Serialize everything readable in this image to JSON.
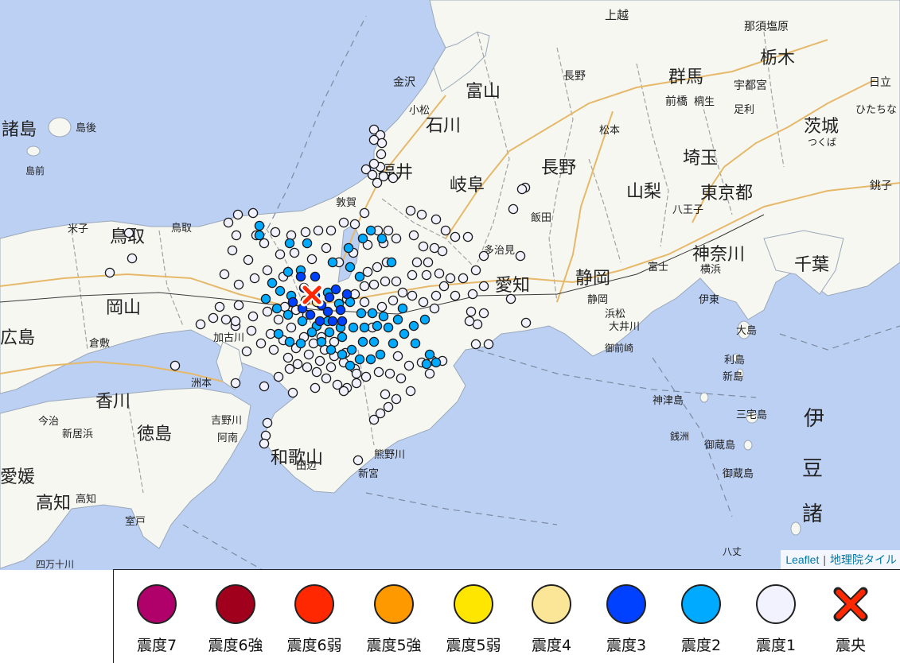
{
  "map": {
    "attribution": {
      "leaflet": "Leaflet",
      "separator": "|",
      "gsi": "地理院タイル"
    },
    "place_labels": [
      {
        "t": "上越",
        "s": 15
      },
      {
        "t": "那須塩原",
        "s": 14
      },
      {
        "t": "栃木",
        "s": 22
      },
      {
        "t": "金沢",
        "s": 14
      },
      {
        "t": "長野",
        "s": 14
      },
      {
        "t": "群馬",
        "s": 22
      },
      {
        "t": "宇都宮",
        "s": 14
      },
      {
        "t": "富山",
        "s": 22
      },
      {
        "t": "前橋",
        "s": 14
      },
      {
        "t": "桐生",
        "s": 13
      },
      {
        "t": "足利",
        "s": 13
      },
      {
        "t": "日立",
        "s": 14
      },
      {
        "t": "小松",
        "s": 13
      },
      {
        "t": "石川",
        "s": 22
      },
      {
        "t": "茨城",
        "s": 22
      },
      {
        "t": "ひたちな",
        "s": 13
      },
      {
        "t": "諸島",
        "s": 22
      },
      {
        "t": "島後",
        "s": 13
      },
      {
        "t": "松本",
        "s": 13
      },
      {
        "t": "福井",
        "s": 22
      },
      {
        "t": "埼玉",
        "s": 22
      },
      {
        "t": "つくば",
        "s": 12
      },
      {
        "t": "長野",
        "s": 22
      },
      {
        "t": "岐阜",
        "s": 22
      },
      {
        "t": "山梨",
        "s": 22
      },
      {
        "t": "東京都",
        "s": 22
      },
      {
        "t": "銚子",
        "s": 14
      },
      {
        "t": "島前",
        "s": 12
      },
      {
        "t": "敦賀",
        "s": 13
      },
      {
        "t": "飯田",
        "s": 13
      },
      {
        "t": "八王子",
        "s": 13
      },
      {
        "t": "鳥取",
        "s": 22
      },
      {
        "t": "鳥取",
        "s": 13
      },
      {
        "t": "米子",
        "s": 13
      },
      {
        "t": "多治見",
        "s": 13
      },
      {
        "t": "神奈川",
        "s": 22
      },
      {
        "t": "千葉",
        "s": 22
      },
      {
        "t": "愛知",
        "s": 22
      },
      {
        "t": "静岡",
        "s": 22
      },
      {
        "t": "富士",
        "s": 13
      },
      {
        "t": "横浜",
        "s": 13
      },
      {
        "t": "岡山",
        "s": 22
      },
      {
        "t": "静岡",
        "s": 13
      },
      {
        "t": "伊東",
        "s": 13
      },
      {
        "t": "浜松",
        "s": 13
      },
      {
        "t": "大井川",
        "s": 13
      },
      {
        "t": "大島",
        "s": 13
      },
      {
        "t": "加古川",
        "s": 13
      },
      {
        "t": "倉敷",
        "s": 13
      },
      {
        "t": "広島",
        "s": 22
      },
      {
        "t": "御前崎",
        "s": 12
      },
      {
        "t": "利島",
        "s": 13
      },
      {
        "t": "新島",
        "s": 13
      },
      {
        "t": "香川",
        "s": 22
      },
      {
        "t": "今治",
        "s": 13
      },
      {
        "t": "洲本",
        "s": 13
      },
      {
        "t": "神津島",
        "s": 13
      },
      {
        "t": "三宅島",
        "s": 13
      },
      {
        "t": "伊",
        "s": 26
      },
      {
        "t": "徳島",
        "s": 22
      },
      {
        "t": "新居浜",
        "s": 13
      },
      {
        "t": "吉野川",
        "s": 13
      },
      {
        "t": "和歌山",
        "s": 22
      },
      {
        "t": "阿南",
        "s": 13
      },
      {
        "t": "銭洲",
        "s": 12
      },
      {
        "t": "御蔵島",
        "s": 13
      },
      {
        "t": "田辺",
        "s": 13
      },
      {
        "t": "熊野川",
        "s": 13
      },
      {
        "t": "豆",
        "s": 26
      },
      {
        "t": "愛媛",
        "s": 22
      },
      {
        "t": "新宮",
        "s": 13
      },
      {
        "t": "御蔵島",
        "s": 13
      },
      {
        "t": "高知",
        "s": 22
      },
      {
        "t": "高知",
        "s": 13
      },
      {
        "t": "諸",
        "s": 26
      },
      {
        "t": "室戸",
        "s": 13
      },
      {
        "t": "八丈",
        "s": 12
      },
      {
        "t": "四万十川",
        "s": 12
      }
    ],
    "epicenter_icon": "x-mark-icon"
  },
  "legend": {
    "items": [
      {
        "label": "震度7",
        "color": "#b0006a",
        "icon": "circle-icon"
      },
      {
        "label": "震度6強",
        "color": "#a0001c",
        "icon": "circle-icon"
      },
      {
        "label": "震度6弱",
        "color": "#ff2800",
        "icon": "circle-icon"
      },
      {
        "label": "震度5強",
        "color": "#ff9900",
        "icon": "circle-icon"
      },
      {
        "label": "震度5弱",
        "color": "#ffe600",
        "icon": "circle-icon"
      },
      {
        "label": "震度4",
        "color": "#fae696",
        "icon": "circle-icon"
      },
      {
        "label": "震度3",
        "color": "#0041ff",
        "icon": "circle-icon"
      },
      {
        "label": "震度2",
        "color": "#00aaff",
        "icon": "circle-icon"
      },
      {
        "label": "震度1",
        "color": "#f2f2ff",
        "icon": "circle-icon"
      },
      {
        "label": "震央",
        "color": "#ff2800",
        "icon": "x-mark-icon"
      }
    ]
  },
  "colors": {
    "sea": "#bcd0f4",
    "land": "#f7f7f2",
    "road": "#e6b96a",
    "shindo4": "#fae696",
    "shindo3": "#0041ff",
    "shindo2": "#00aaff",
    "shindo1": "#f2f2ff",
    "epicenter": "#ff2800"
  }
}
